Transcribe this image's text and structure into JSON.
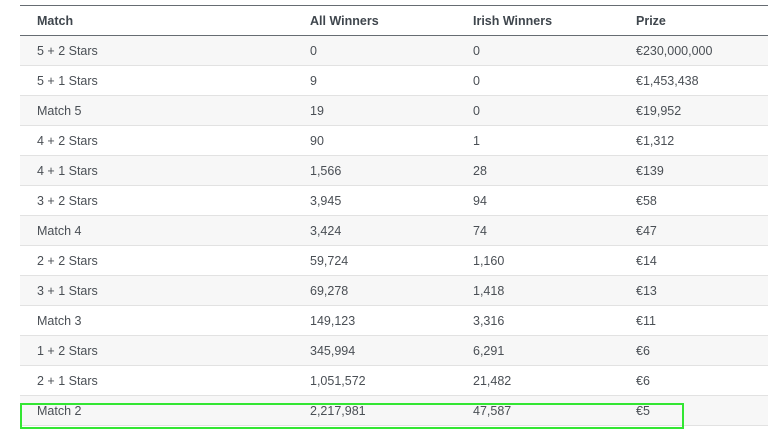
{
  "table": {
    "headers": {
      "match": "Match",
      "all_winners": "All Winners",
      "irish_winners": "Irish Winners",
      "prize": "Prize"
    },
    "rows": [
      {
        "match": "5 + 2 Stars",
        "all_winners": "0",
        "irish_winners": "0",
        "prize": "€230,000,000"
      },
      {
        "match": "5 + 1 Stars",
        "all_winners": "9",
        "irish_winners": "0",
        "prize": "€1,453,438"
      },
      {
        "match": "Match 5",
        "all_winners": "19",
        "irish_winners": "0",
        "prize": "€19,952"
      },
      {
        "match": "4 + 2 Stars",
        "all_winners": "90",
        "irish_winners": "1",
        "prize": "€1,312"
      },
      {
        "match": "4 + 1 Stars",
        "all_winners": "1,566",
        "irish_winners": "28",
        "prize": "€139"
      },
      {
        "match": "3 + 2 Stars",
        "all_winners": "3,945",
        "irish_winners": "94",
        "prize": "€58"
      },
      {
        "match": "Match 4",
        "all_winners": "3,424",
        "irish_winners": "74",
        "prize": "€47"
      },
      {
        "match": "2 + 2 Stars",
        "all_winners": "59,724",
        "irish_winners": "1,160",
        "prize": "€14"
      },
      {
        "match": "3 + 1 Stars",
        "all_winners": "69,278",
        "irish_winners": "1,418",
        "prize": "€13"
      },
      {
        "match": "Match 3",
        "all_winners": "149,123",
        "irish_winners": "3,316",
        "prize": "€11"
      },
      {
        "match": "1 + 2 Stars",
        "all_winners": "345,994",
        "irish_winners": "6,291",
        "prize": "€6"
      },
      {
        "match": "2 + 1 Stars",
        "all_winners": "1,051,572",
        "irish_winners": "21,482",
        "prize": "€6"
      },
      {
        "match": "Match 2",
        "all_winners": "2,217,981",
        "irish_winners": "47,587",
        "prize": "€5"
      }
    ],
    "highlight_color": "#33e633"
  }
}
